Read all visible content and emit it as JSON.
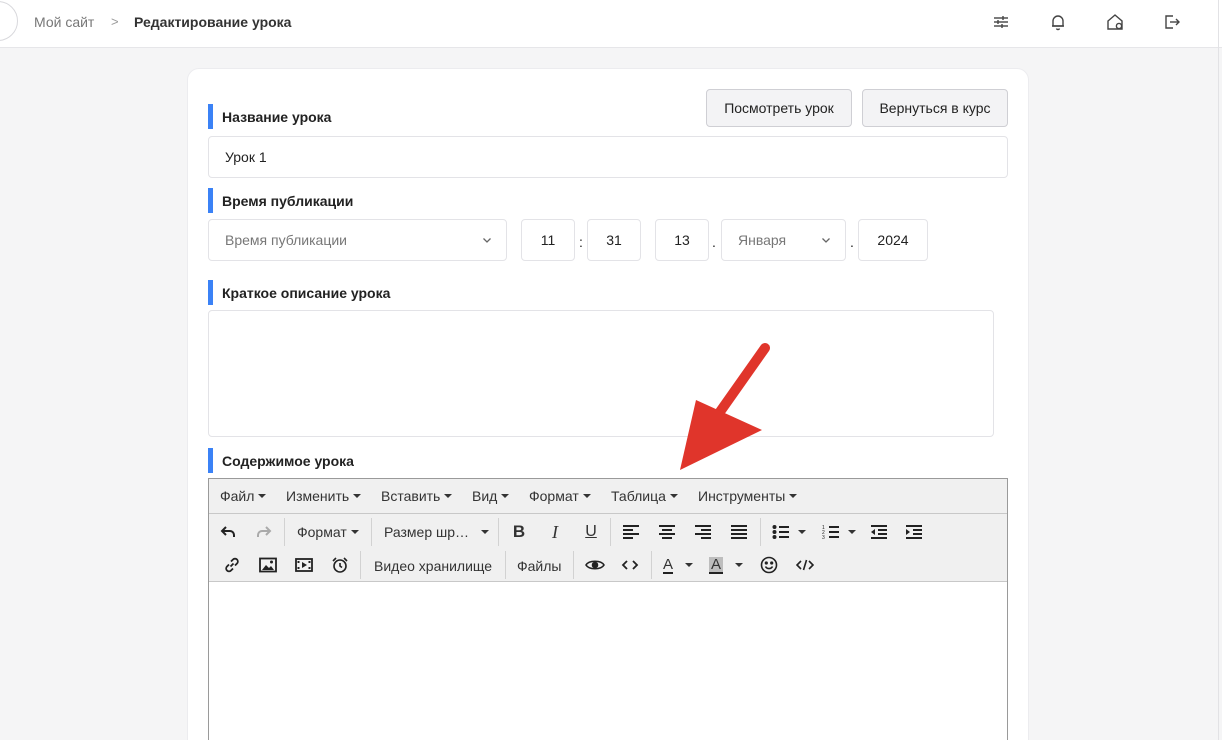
{
  "breadcrumb": {
    "home": "Мой сайт",
    "separator": ">",
    "current": "Редактирование урока"
  },
  "header_icons": [
    "sliders-icon",
    "bell-icon",
    "home-settings-icon",
    "logout-icon"
  ],
  "actions": {
    "view_lesson": "Посмотреть урок",
    "back_to_course": "Вернуться в курс"
  },
  "lesson_name": {
    "label": "Название урока",
    "value": "Урок 1"
  },
  "publication": {
    "label": "Время публикации",
    "select_placeholder": "Время публикации",
    "hour": "11",
    "time_sep": ":",
    "minute": "31",
    "day": "13",
    "date_sep": ".",
    "month": "Января",
    "year": "2024"
  },
  "short_description": {
    "label": "Краткое описание урока",
    "value": ""
  },
  "content": {
    "label": "Содержимое урока",
    "menu": [
      "Файл",
      "Изменить",
      "Вставить",
      "Вид",
      "Формат",
      "Таблица",
      "Инструменты"
    ],
    "format_dropdown": "Формат",
    "font_size_dropdown": "Размер шр…",
    "video_storage": "Видео хранилище",
    "files": "Файлы"
  },
  "colors": {
    "accent": "#3b82f6",
    "arrow": "#e0352b"
  }
}
